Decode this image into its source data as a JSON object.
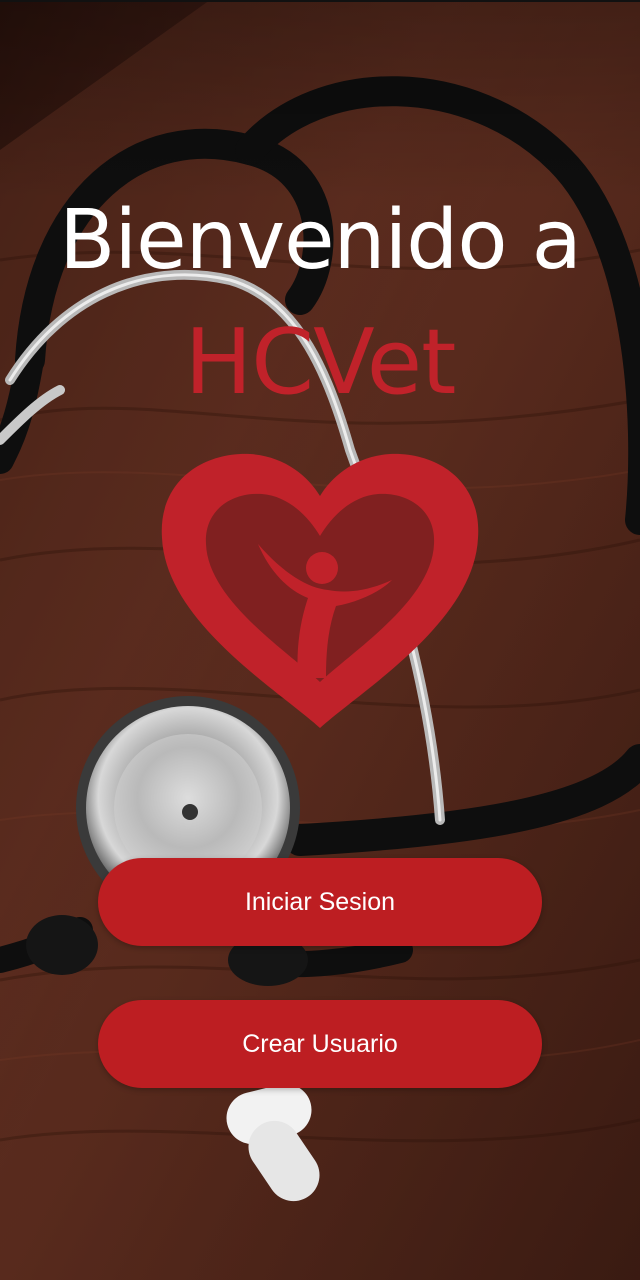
{
  "welcome": {
    "line1": "Bienvenido a",
    "app_name": "HCVet"
  },
  "logo": {
    "icon": "heart-person-logo-icon",
    "color": "#c0222a"
  },
  "actions": {
    "login_label": "Iniciar Sesion",
    "register_label": "Crear Usuario",
    "button_color": "#bd1e22"
  },
  "background": {
    "description_icon": "stethoscope-photo"
  }
}
